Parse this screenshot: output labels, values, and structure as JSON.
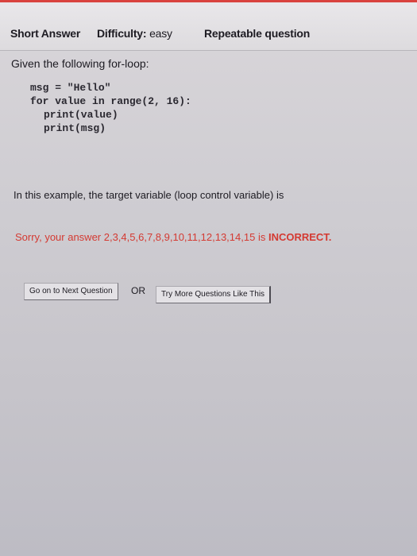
{
  "header": {
    "question_type": "Short Answer",
    "difficulty_label": "Difficulty:",
    "difficulty_value": "easy",
    "repeatable": "Repeatable question"
  },
  "question": {
    "intro": "Given the following for-loop:",
    "code_lines": [
      "msg = \"Hello\"",
      "for value in range(2, 16):",
      "print(value)",
      "print(msg)"
    ],
    "prompt": "In this example, the target variable (loop control variable) is"
  },
  "feedback": {
    "message": "Sorry, your answer 2,3,4,5,6,7,8,9,10,11,12,13,14,15 is",
    "status": "INCORRECT."
  },
  "actions": {
    "next_question": "Go on to Next Question",
    "or_label": "OR",
    "more_questions": "Try More Questions Like This"
  },
  "colors": {
    "top_border": "#d9423e",
    "feedback_text": "#d43a32"
  }
}
